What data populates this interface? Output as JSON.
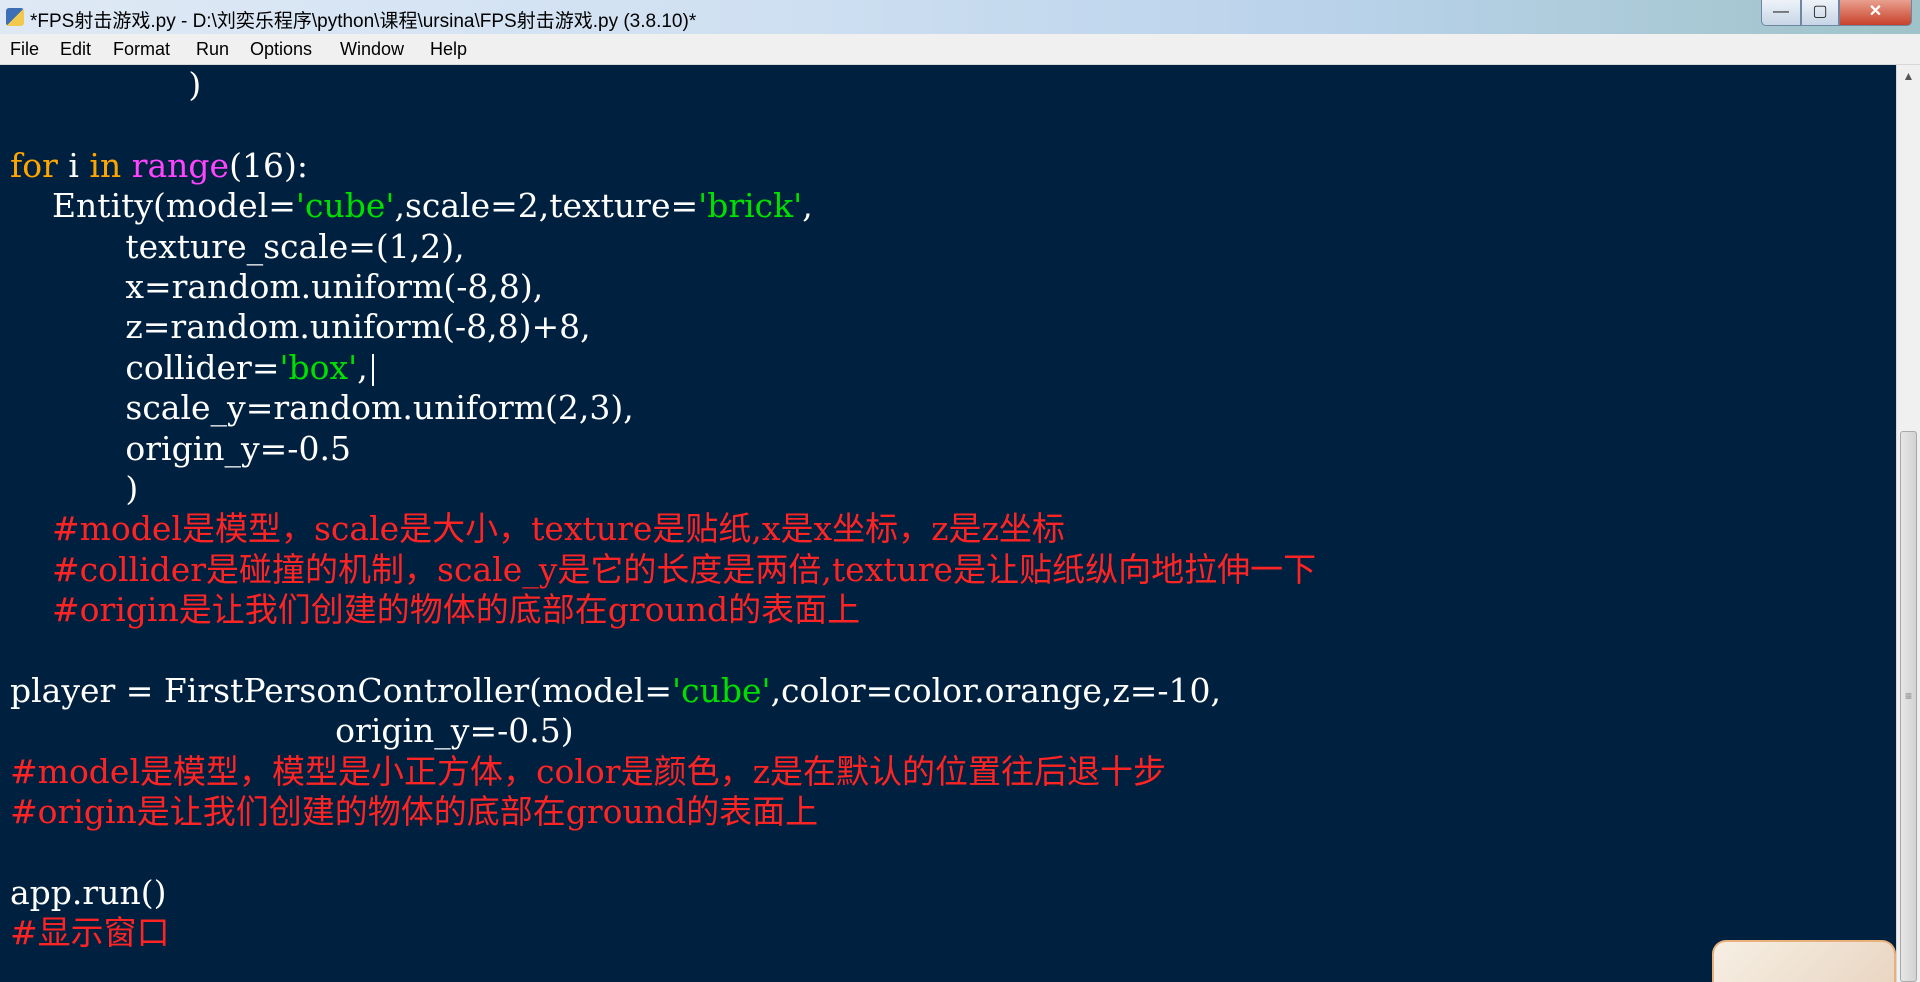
{
  "window": {
    "title": "*FPS射击游戏.py - D:\\刘奕乐程序\\python\\课程\\ursina\\FPS射击游戏.py (3.8.10)*",
    "controls": {
      "minimize": "—",
      "maximize": "▢",
      "close": "✕"
    }
  },
  "menu": [
    "File",
    "Edit",
    "Format",
    "Run",
    "Options",
    "Window",
    "Help"
  ],
  "editor": {
    "lines": [
      [
        {
          "t": "                 )",
          "c": "n"
        }
      ],
      [],
      [
        {
          "t": "for",
          "c": "kw"
        },
        {
          "t": " i ",
          "c": "n"
        },
        {
          "t": "in",
          "c": "kw"
        },
        {
          "t": " ",
          "c": "n"
        },
        {
          "t": "range",
          "c": "bi"
        },
        {
          "t": "(16):",
          "c": "n"
        }
      ],
      [
        {
          "t": "    Entity(model=",
          "c": "n"
        },
        {
          "t": "'cube'",
          "c": "str"
        },
        {
          "t": ",scale=2,texture=",
          "c": "n"
        },
        {
          "t": "'brick'",
          "c": "str"
        },
        {
          "t": ",",
          "c": "n"
        }
      ],
      [
        {
          "t": "           texture_scale=(1,2),",
          "c": "n"
        }
      ],
      [
        {
          "t": "           x=random.uniform(-8,8),",
          "c": "n"
        }
      ],
      [
        {
          "t": "           z=random.uniform(-8,8)+8,",
          "c": "n"
        }
      ],
      [
        {
          "t": "           collider=",
          "c": "n"
        },
        {
          "t": "'box'",
          "c": "str"
        },
        {
          "t": ",",
          "c": "n"
        }
      ],
      [
        {
          "t": "           scale_y=random.uniform(2,3),",
          "c": "n"
        }
      ],
      [
        {
          "t": "           origin_y=-0.5",
          "c": "n"
        }
      ],
      [
        {
          "t": "           )",
          "c": "n"
        }
      ],
      [
        {
          "t": "    #model是模型，scale是大小，texture是贴纸,x是x坐标，z是z坐标",
          "c": "cm"
        }
      ],
      [
        {
          "t": "    #collider是碰撞的机制，scale_y是它的长度是两倍,texture是让贴纸纵向地拉伸一下",
          "c": "cm"
        }
      ],
      [
        {
          "t": "    #origin是让我们创建的物体的底部在ground的表面上",
          "c": "cm"
        }
      ],
      [],
      [
        {
          "t": "player = FirstPersonController(model=",
          "c": "n"
        },
        {
          "t": "'cube'",
          "c": "str"
        },
        {
          "t": ",color=color.orange,z=-10,",
          "c": "n"
        }
      ],
      [
        {
          "t": "                               origin_y=-0.5)",
          "c": "n"
        }
      ],
      [
        {
          "t": "#model是模型，模型是小正方体，color是颜色，z是在默认的位置往后退十步",
          "c": "cm"
        }
      ],
      [
        {
          "t": "#origin是让我们创建的物体的底部在ground的表面上",
          "c": "cm"
        }
      ],
      [],
      [
        {
          "t": "app.run()",
          "c": "n"
        }
      ],
      [
        {
          "t": "#显示窗口",
          "c": "cm"
        }
      ]
    ],
    "cursor_line": 7
  },
  "colors": {
    "background": "#00203f",
    "default": "#ffffff",
    "keyword": "#ffa500",
    "builtin": "#ff44ff",
    "string": "#00e000",
    "comment": "#ff2424"
  }
}
